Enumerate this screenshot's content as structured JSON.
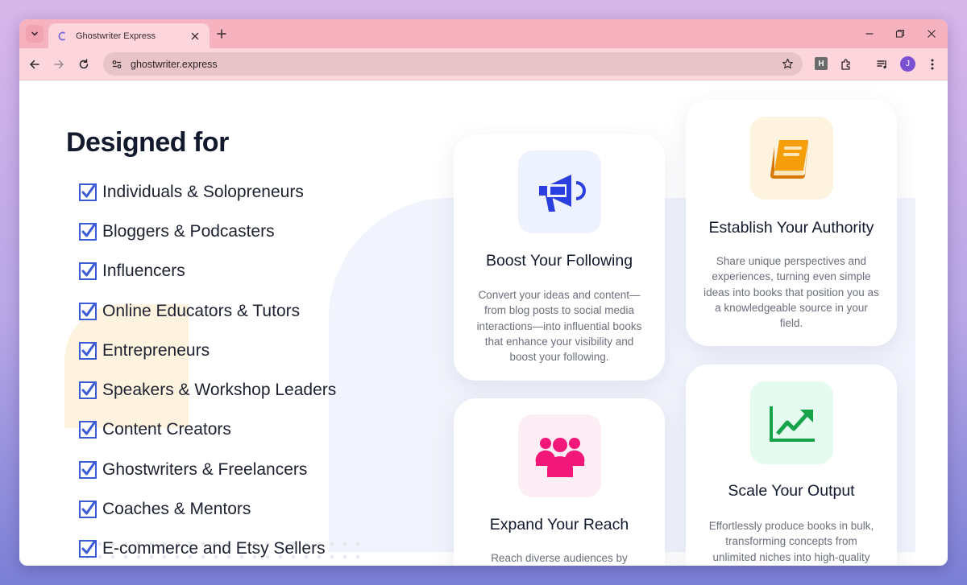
{
  "browser": {
    "tab_title": "Ghostwriter Express",
    "url": "ghostwriter.express",
    "extension_letter": "H",
    "profile_initial": "J"
  },
  "colors": {
    "tabbar": "#f6b3bf",
    "toolbar": "#fdd6dd",
    "check": "#3b5bd6",
    "megaphone": "#2b3fe0",
    "book": "#f59e0b",
    "people": "#f2187a",
    "chart": "#16a34a"
  },
  "page": {
    "heading": "Designed for",
    "audiences": [
      "Individuals & Solopreneurs",
      "Bloggers & Podcasters",
      "Influencers",
      "Online Educators & Tutors",
      "Entrepreneurs",
      "Speakers & Workshop Leaders",
      "Content Creators",
      "Ghostwriters & Freelancers",
      "Coaches & Mentors",
      "E-commerce and Etsy Sellers"
    ],
    "cards": [
      {
        "icon": "megaphone-icon",
        "title": "Boost Your Following",
        "text": "Convert your ideas and content—from blog posts to social media interactions—into influential books that enhance your visibility and boost your following."
      },
      {
        "icon": "book-icon",
        "title": "Establish Your Authority",
        "text": "Share unique perspectives and experiences, turning even simple ideas into books that position you as a knowledgeable source in your field."
      },
      {
        "icon": "people-icon",
        "title": "Expand Your Reach",
        "text": "Reach diverse audiences by creating books tailored to varied"
      },
      {
        "icon": "chart-up-icon",
        "title": "Scale Your Output",
        "text": "Effortlessly produce books in bulk, transforming concepts from unlimited niches into high-quality publications that rapidly enhance"
      }
    ]
  }
}
